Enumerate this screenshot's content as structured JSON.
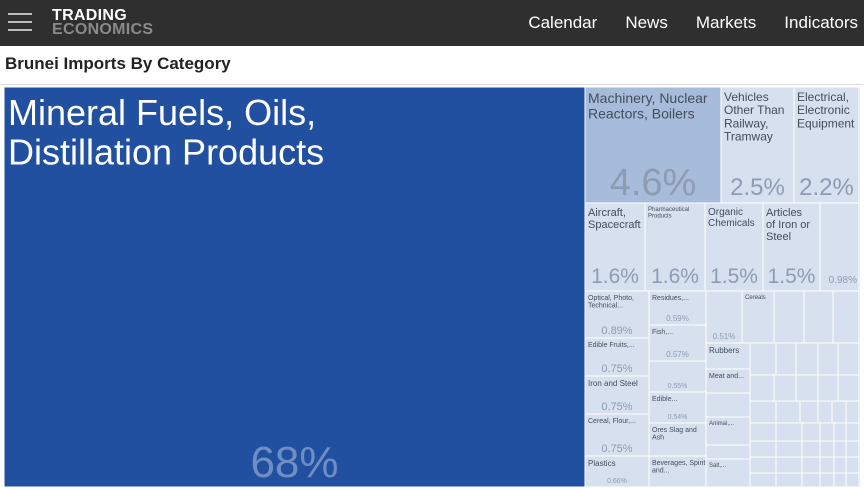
{
  "header": {
    "logo_line1": "TRADING",
    "logo_line2": "ECONOMICS",
    "nav": [
      "Calendar",
      "News",
      "Markets",
      "Indicators"
    ]
  },
  "page": {
    "title": "Brunei Imports By Category"
  },
  "colors": {
    "navbar": "#2f2f2f",
    "main_tile": "#2150a0",
    "tile_medium": "#a7bbdb",
    "tile_light": "#d6e0ee",
    "tile_border": "#ffffff",
    "label_light": "#8e9cb3"
  },
  "chart_data": {
    "type": "treemap",
    "title": "Brunei Imports By Category",
    "categories": [
      {
        "name": "Mineral Fuels, Oils, Distillation Products",
        "value": 68,
        "label": "68%"
      },
      {
        "name": "Machinery, Nuclear Reactors, Boilers",
        "value": 4.6,
        "label": "4.6%"
      },
      {
        "name": "Vehicles Other Than Railway, Tramway",
        "value": 2.5,
        "label": "2.5%"
      },
      {
        "name": "Electrical, Electronic Equipment",
        "value": 2.2,
        "label": "2.2%"
      },
      {
        "name": "Aircraft, Spacecraft",
        "value": 1.6,
        "label": "1.6%"
      },
      {
        "name": "Pharmaceutical Products",
        "value": 1.6,
        "label": "1.6%"
      },
      {
        "name": "Organic Chemicals",
        "value": 1.5,
        "label": "1.5%"
      },
      {
        "name": "Articles of Iron or Steel",
        "value": 1.5,
        "label": "1.5%"
      },
      {
        "name": "",
        "value": 0.98,
        "label": "0.98%"
      },
      {
        "name": "Optical, Photo, Technical...",
        "value": 0.89,
        "label": "0.89%"
      },
      {
        "name": "Residues,...",
        "value": 0.59,
        "label": "0.59%"
      },
      {
        "name": "Fish,...",
        "value": 0.57,
        "label": "0.57%"
      },
      {
        "name": "",
        "value": 0.51,
        "label": "0.51%"
      },
      {
        "name": "Cereals",
        "value": null,
        "label": ""
      },
      {
        "name": "Edible Fruits,...",
        "value": 0.75,
        "label": "0.75%"
      },
      {
        "name": "Iron and Steel",
        "value": 0.75,
        "label": "0.75%"
      },
      {
        "name": "Cereal, Flour,...",
        "value": 0.75,
        "label": "0.75%"
      },
      {
        "name": "Plastics",
        "value": 0.66,
        "label": "0.66%"
      },
      {
        "name": "",
        "value": 0.55,
        "label": "0.55%"
      },
      {
        "name": "Edible...",
        "value": 0.54,
        "label": "0.54%"
      },
      {
        "name": "Ores Slag and Ash",
        "value": null,
        "label": ""
      },
      {
        "name": "Beverages, Spirits and...",
        "value": null,
        "label": ""
      },
      {
        "name": "Rubbers",
        "value": null,
        "label": ""
      },
      {
        "name": "Meat and...",
        "value": null,
        "label": ""
      },
      {
        "name": "Animal,...",
        "value": null,
        "label": ""
      },
      {
        "name": "Salt,...",
        "value": null,
        "label": ""
      }
    ]
  }
}
